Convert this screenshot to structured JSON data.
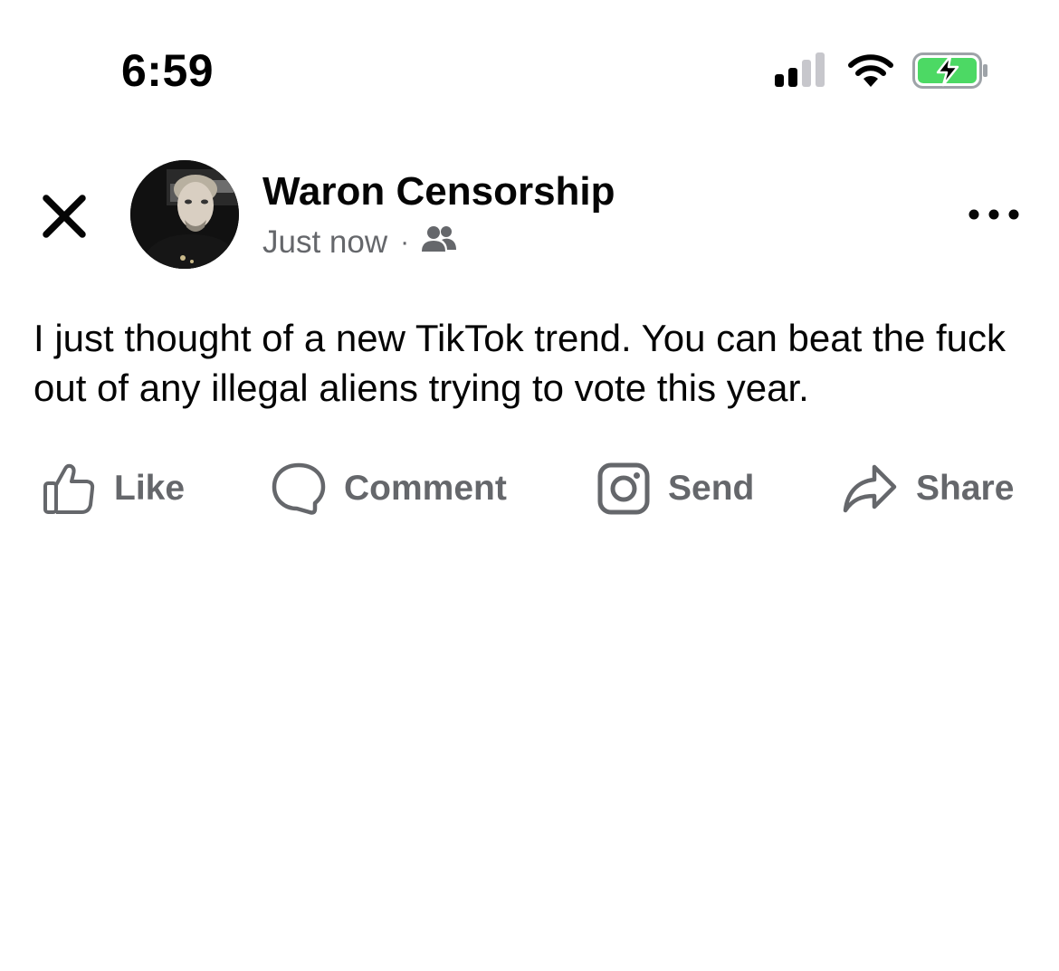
{
  "status_bar": {
    "time": "6:59",
    "icons": [
      "signal-icon",
      "wifi-icon",
      "battery-charging-icon"
    ],
    "battery_color": "#4cd964"
  },
  "header": {
    "close_icon": "close-icon",
    "author_name": "Waron Censorship",
    "timestamp": "Just now",
    "separator": "·",
    "audience_icon": "friends-icon",
    "more_icon": "more-horizontal-icon"
  },
  "post": {
    "text": "I just thought of a new TikTok trend. You can beat the fuck out of any illegal aliens trying to vote this year."
  },
  "actions": {
    "like_label": "Like",
    "comment_label": "Comment",
    "send_label": "Send",
    "share_label": "Share",
    "icon_color": "#65676b"
  }
}
